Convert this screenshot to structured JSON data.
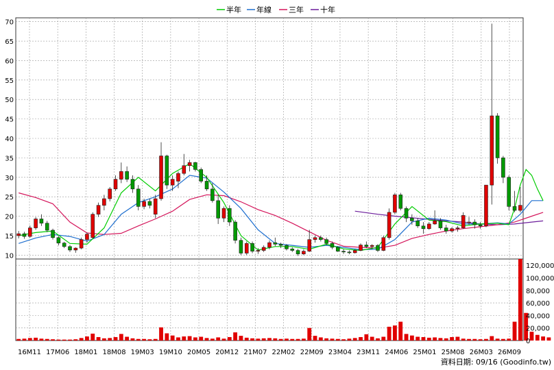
{
  "legend": [
    {
      "name": "半年",
      "color": "#00cc00"
    },
    {
      "name": "年線",
      "color": "#1e6fcf"
    },
    {
      "name": "三年",
      "color": "#d4145a"
    },
    {
      "name": "十年",
      "color": "#6a1b9a"
    }
  ],
  "source_note": "資料日期: 09/16  (Goodinfo.tw)",
  "colors": {
    "up": "#e00000",
    "down": "#009900",
    "volume": "#e00000",
    "grid": "#999999",
    "background": "#ffffff"
  },
  "chart_data": {
    "type": "candlestick+volume",
    "x_tick_labels": [
      "16M11",
      "17M06",
      "18M01",
      "18M08",
      "19M03",
      "19M10",
      "20M05",
      "20M12",
      "21M07",
      "22M02",
      "22M09",
      "23M04",
      "23M11",
      "24M06",
      "25M01",
      "25M08",
      "26M03",
      "26M09"
    ],
    "price_axis": {
      "ylim": [
        9,
        71
      ],
      "ticks": [
        10,
        15,
        20,
        25,
        30,
        35,
        40,
        45,
        50,
        55,
        60,
        65,
        70
      ]
    },
    "volume_axis": {
      "ylim": [
        0,
        130000
      ],
      "ticks": [
        0,
        20000,
        40000,
        60000,
        80000,
        100000,
        120000
      ],
      "tick_labels": [
        "0",
        "20,000",
        "40,000",
        "60,000",
        "80,000",
        "100,000",
        "120,000"
      ]
    },
    "grid": true,
    "legend_position": "top-center",
    "candles": [
      {
        "o": 15.0,
        "h": 16.2,
        "l": 14.3,
        "c": 15.5
      },
      {
        "o": 15.5,
        "h": 16.0,
        "l": 14.2,
        "c": 14.8
      },
      {
        "o": 14.8,
        "h": 17.6,
        "l": 14.5,
        "c": 17.0
      },
      {
        "o": 17.0,
        "h": 19.8,
        "l": 16.5,
        "c": 19.3
      },
      {
        "o": 19.3,
        "h": 20.5,
        "l": 17.5,
        "c": 18.2
      },
      {
        "o": 18.2,
        "h": 18.8,
        "l": 15.9,
        "c": 16.4
      },
      {
        "o": 16.4,
        "h": 16.8,
        "l": 14.0,
        "c": 14.5
      },
      {
        "o": 14.5,
        "h": 14.9,
        "l": 12.5,
        "c": 13.1
      },
      {
        "o": 13.1,
        "h": 13.4,
        "l": 11.8,
        "c": 12.2
      },
      {
        "o": 12.2,
        "h": 12.6,
        "l": 10.8,
        "c": 11.3
      },
      {
        "o": 11.3,
        "h": 12.0,
        "l": 10.6,
        "c": 11.8
      },
      {
        "o": 11.8,
        "h": 14.5,
        "l": 11.5,
        "c": 14.0
      },
      {
        "o": 14.0,
        "h": 15.8,
        "l": 13.2,
        "c": 15.4
      },
      {
        "o": 14.5,
        "h": 21.0,
        "l": 14.2,
        "c": 20.5
      },
      {
        "o": 20.5,
        "h": 23.5,
        "l": 19.8,
        "c": 22.8
      },
      {
        "o": 22.8,
        "h": 25.5,
        "l": 21.5,
        "c": 24.5
      },
      {
        "o": 24.5,
        "h": 27.5,
        "l": 23.8,
        "c": 27.0
      },
      {
        "o": 27.0,
        "h": 30.5,
        "l": 26.5,
        "c": 29.5
      },
      {
        "o": 29.5,
        "h": 33.8,
        "l": 28.5,
        "c": 31.5
      },
      {
        "o": 31.5,
        "h": 32.8,
        "l": 28.8,
        "c": 29.5
      },
      {
        "o": 29.5,
        "h": 30.5,
        "l": 26.0,
        "c": 27.0
      },
      {
        "o": 27.0,
        "h": 28.0,
        "l": 21.5,
        "c": 22.5
      },
      {
        "o": 22.5,
        "h": 24.5,
        "l": 21.8,
        "c": 23.8
      },
      {
        "o": 23.8,
        "h": 24.5,
        "l": 22.0,
        "c": 22.8
      },
      {
        "o": 20.5,
        "h": 25.5,
        "l": 19.5,
        "c": 24.5
      },
      {
        "o": 24.5,
        "h": 39.0,
        "l": 24.0,
        "c": 35.5
      },
      {
        "o": 35.5,
        "h": 35.8,
        "l": 27.0,
        "c": 28.0
      },
      {
        "o": 28.0,
        "h": 30.5,
        "l": 26.5,
        "c": 29.5
      },
      {
        "o": 29.0,
        "h": 31.5,
        "l": 27.2,
        "c": 31.0
      },
      {
        "o": 31.0,
        "h": 36.0,
        "l": 30.5,
        "c": 33.0
      },
      {
        "o": 33.0,
        "h": 34.5,
        "l": 31.5,
        "c": 33.8
      },
      {
        "o": 33.8,
        "h": 34.0,
        "l": 31.5,
        "c": 32.0
      },
      {
        "o": 32.0,
        "h": 32.5,
        "l": 28.5,
        "c": 29.0
      },
      {
        "o": 29.0,
        "h": 30.5,
        "l": 26.5,
        "c": 27.0
      },
      {
        "o": 27.0,
        "h": 28.5,
        "l": 23.5,
        "c": 24.0
      },
      {
        "o": 24.0,
        "h": 25.5,
        "l": 18.0,
        "c": 19.5
      },
      {
        "o": 19.5,
        "h": 22.5,
        "l": 18.5,
        "c": 22.0
      },
      {
        "o": 22.0,
        "h": 22.8,
        "l": 17.5,
        "c": 18.5
      },
      {
        "o": 18.5,
        "h": 19.0,
        "l": 13.0,
        "c": 13.8
      },
      {
        "o": 13.8,
        "h": 14.5,
        "l": 10.0,
        "c": 10.5
      },
      {
        "o": 10.5,
        "h": 13.5,
        "l": 10.0,
        "c": 13.0
      },
      {
        "o": 13.0,
        "h": 13.5,
        "l": 10.5,
        "c": 11.0
      },
      {
        "o": 11.0,
        "h": 11.8,
        "l": 10.3,
        "c": 11.2
      },
      {
        "o": 11.2,
        "h": 12.5,
        "l": 10.8,
        "c": 12.0
      },
      {
        "o": 12.0,
        "h": 13.8,
        "l": 11.5,
        "c": 13.2
      },
      {
        "o": 13.2,
        "h": 14.5,
        "l": 12.3,
        "c": 12.8
      },
      {
        "o": 12.8,
        "h": 13.2,
        "l": 11.8,
        "c": 12.5
      },
      {
        "o": 12.5,
        "h": 12.8,
        "l": 11.2,
        "c": 11.6
      },
      {
        "o": 11.6,
        "h": 12.0,
        "l": 10.8,
        "c": 11.2
      },
      {
        "o": 11.2,
        "h": 11.6,
        "l": 9.8,
        "c": 10.3
      },
      {
        "o": 10.3,
        "h": 11.5,
        "l": 10.0,
        "c": 11.0
      },
      {
        "o": 11.0,
        "h": 16.5,
        "l": 10.8,
        "c": 14.0
      },
      {
        "o": 14.0,
        "h": 15.0,
        "l": 13.2,
        "c": 14.5
      },
      {
        "o": 14.5,
        "h": 15.0,
        "l": 13.5,
        "c": 14.0
      },
      {
        "o": 14.0,
        "h": 14.5,
        "l": 12.5,
        "c": 13.0
      },
      {
        "o": 13.0,
        "h": 13.5,
        "l": 11.5,
        "c": 12.0
      },
      {
        "o": 12.0,
        "h": 12.3,
        "l": 10.8,
        "c": 11.0
      },
      {
        "o": 11.0,
        "h": 11.5,
        "l": 10.3,
        "c": 10.8
      },
      {
        "o": 10.8,
        "h": 11.2,
        "l": 10.2,
        "c": 10.6
      },
      {
        "o": 10.6,
        "h": 11.5,
        "l": 10.4,
        "c": 11.2
      },
      {
        "o": 11.2,
        "h": 13.0,
        "l": 11.0,
        "c": 12.6
      },
      {
        "o": 12.6,
        "h": 13.5,
        "l": 11.8,
        "c": 12.2
      },
      {
        "o": 12.2,
        "h": 12.8,
        "l": 11.5,
        "c": 12.5
      },
      {
        "o": 12.5,
        "h": 12.8,
        "l": 10.8,
        "c": 11.2
      },
      {
        "o": 11.2,
        "h": 15.0,
        "l": 11.0,
        "c": 14.5
      },
      {
        "o": 14.5,
        "h": 22.0,
        "l": 14.0,
        "c": 21.0
      },
      {
        "o": 21.0,
        "h": 26.0,
        "l": 20.5,
        "c": 25.5
      },
      {
        "o": 25.5,
        "h": 26.0,
        "l": 21.5,
        "c": 22.0
      },
      {
        "o": 22.0,
        "h": 22.5,
        "l": 18.5,
        "c": 19.5
      },
      {
        "o": 19.5,
        "h": 20.5,
        "l": 17.8,
        "c": 18.8
      },
      {
        "o": 18.8,
        "h": 19.5,
        "l": 17.0,
        "c": 17.5
      },
      {
        "o": 17.5,
        "h": 18.5,
        "l": 15.5,
        "c": 16.8
      },
      {
        "o": 16.8,
        "h": 18.5,
        "l": 16.5,
        "c": 18.0
      },
      {
        "o": 18.0,
        "h": 21.5,
        "l": 17.8,
        "c": 18.8
      },
      {
        "o": 18.8,
        "h": 19.5,
        "l": 16.5,
        "c": 17.0
      },
      {
        "o": 17.0,
        "h": 17.8,
        "l": 15.5,
        "c": 16.2
      },
      {
        "o": 16.2,
        "h": 17.2,
        "l": 15.8,
        "c": 16.8
      },
      {
        "o": 16.8,
        "h": 17.5,
        "l": 16.0,
        "c": 17.0
      },
      {
        "o": 17.0,
        "h": 21.0,
        "l": 16.8,
        "c": 20.2
      },
      {
        "o": 18.5,
        "h": 19.8,
        "l": 17.8,
        "c": 18.5
      },
      {
        "o": 18.5,
        "h": 19.2,
        "l": 16.8,
        "c": 17.8
      },
      {
        "o": 17.8,
        "h": 18.5,
        "l": 16.8,
        "c": 17.5
      },
      {
        "o": 17.5,
        "h": 28.0,
        "l": 17.2,
        "c": 28.0
      },
      {
        "o": 28.0,
        "h": 69.5,
        "l": 23.0,
        "c": 45.8
      },
      {
        "o": 45.8,
        "h": 46.5,
        "l": 33.5,
        "c": 35.0
      },
      {
        "o": 35.0,
        "h": 35.5,
        "l": 28.5,
        "c": 30.0
      },
      {
        "o": 30.0,
        "h": 30.5,
        "l": 21.5,
        "c": 22.5
      },
      {
        "o": 22.5,
        "h": 26.5,
        "l": 21.0,
        "c": 21.5
      },
      {
        "o": 21.5,
        "h": 27.5,
        "l": 21.0,
        "c": 22.8
      }
    ],
    "volume": [
      2500,
      3000,
      4000,
      4500,
      3000,
      2500,
      2000,
      1500,
      1500,
      1500,
      2000,
      4000,
      6500,
      11000,
      5500,
      3500,
      4000,
      5500,
      10500,
      6000,
      3500,
      2500,
      2500,
      2000,
      2500,
      21000,
      11500,
      8000,
      5000,
      6500,
      7000,
      5000,
      6000,
      4000,
      3000,
      5000,
      3000,
      5500,
      13000,
      7500,
      4500,
      3500,
      3000,
      3500,
      4000,
      3500,
      2500,
      3000,
      2500,
      2500,
      3000,
      20000,
      7500,
      5000,
      3500,
      3000,
      2500,
      2000,
      3000,
      4000,
      5500,
      10000,
      6000,
      3500,
      6000,
      22000,
      24000,
      30000,
      10500,
      8000,
      6000,
      5500,
      4500,
      5000,
      4000,
      3500,
      5500,
      6000,
      3000,
      2500,
      2500,
      2000,
      2500,
      7000,
      3000,
      2500,
      3000,
      30000,
      130000,
      44000,
      14000,
      9000,
      6500,
      5000
    ],
    "ma_half_year": [
      [
        0,
        15.0
      ],
      [
        3,
        15.8
      ],
      [
        6,
        16.2
      ],
      [
        9,
        13.0
      ],
      [
        12,
        12.8
      ],
      [
        15,
        17.0
      ],
      [
        18,
        26.0
      ],
      [
        21,
        30.0
      ],
      [
        24,
        26.5
      ],
      [
        27,
        31.0
      ],
      [
        30,
        33.5
      ],
      [
        33,
        30.0
      ],
      [
        36,
        23.5
      ],
      [
        39,
        15.0
      ],
      [
        42,
        11.3
      ],
      [
        45,
        12.2
      ],
      [
        48,
        12.2
      ],
      [
        51,
        11.5
      ],
      [
        54,
        12.8
      ],
      [
        57,
        11.6
      ],
      [
        60,
        11.2
      ],
      [
        63,
        12.0
      ],
      [
        66,
        18.0
      ],
      [
        69,
        22.5
      ],
      [
        72,
        19.0
      ],
      [
        75,
        18.6
      ],
      [
        78,
        17.5
      ],
      [
        81,
        18.0
      ],
      [
        84,
        18.2
      ],
      [
        86,
        17.8
      ],
      [
        87,
        22.0
      ],
      [
        88,
        28.0
      ],
      [
        89,
        32.0
      ],
      [
        90,
        30.5
      ],
      [
        91,
        27.0
      ],
      [
        92,
        24.0
      ]
    ],
    "ma_year": [
      [
        0,
        13.0
      ],
      [
        3,
        14.4
      ],
      [
        6,
        15.3
      ],
      [
        9,
        14.8
      ],
      [
        12,
        13.6
      ],
      [
        15,
        15.3
      ],
      [
        18,
        20.5
      ],
      [
        21,
        23.5
      ],
      [
        24,
        25.0
      ],
      [
        27,
        27.0
      ],
      [
        30,
        30.5
      ],
      [
        33,
        29.8
      ],
      [
        36,
        26.2
      ],
      [
        39,
        22.0
      ],
      [
        42,
        16.5
      ],
      [
        45,
        13.0
      ],
      [
        48,
        12.5
      ],
      [
        51,
        12.0
      ],
      [
        54,
        12.5
      ],
      [
        57,
        12.0
      ],
      [
        60,
        11.4
      ],
      [
        63,
        11.5
      ],
      [
        66,
        14.0
      ],
      [
        69,
        18.5
      ],
      [
        72,
        19.5
      ],
      [
        75,
        19.0
      ],
      [
        78,
        18.0
      ],
      [
        81,
        18.0
      ],
      [
        84,
        18.3
      ],
      [
        86,
        18.0
      ],
      [
        88,
        20.5
      ],
      [
        90,
        24.0
      ],
      [
        92,
        24.0
      ]
    ],
    "ma_three_year": [
      [
        0,
        26.0
      ],
      [
        3,
        24.8
      ],
      [
        6,
        23.2
      ],
      [
        9,
        18.5
      ],
      [
        12,
        15.7
      ],
      [
        15,
        15.3
      ],
      [
        18,
        15.6
      ],
      [
        21,
        17.5
      ],
      [
        24,
        19.3
      ],
      [
        27,
        21.3
      ],
      [
        30,
        24.3
      ],
      [
        33,
        25.5
      ],
      [
        36,
        25.3
      ],
      [
        39,
        23.7
      ],
      [
        42,
        21.7
      ],
      [
        45,
        20.2
      ],
      [
        48,
        18.2
      ],
      [
        51,
        16.0
      ],
      [
        54,
        13.8
      ],
      [
        57,
        12.3
      ],
      [
        60,
        12.0
      ],
      [
        63,
        11.8
      ],
      [
        66,
        12.5
      ],
      [
        69,
        14.3
      ],
      [
        72,
        15.3
      ],
      [
        75,
        16.2
      ],
      [
        78,
        16.8
      ],
      [
        81,
        17.3
      ],
      [
        84,
        17.8
      ],
      [
        87,
        18.5
      ],
      [
        90,
        20.0
      ],
      [
        92,
        21.0
      ]
    ],
    "ma_ten_year": [
      [
        59,
        21.3
      ],
      [
        63,
        20.5
      ],
      [
        66,
        20.0
      ],
      [
        69,
        19.6
      ],
      [
        72,
        19.2
      ],
      [
        75,
        18.8
      ],
      [
        78,
        18.5
      ],
      [
        81,
        18.0
      ],
      [
        84,
        17.8
      ],
      [
        87,
        18.0
      ],
      [
        90,
        18.5
      ],
      [
        92,
        18.8
      ]
    ]
  }
}
